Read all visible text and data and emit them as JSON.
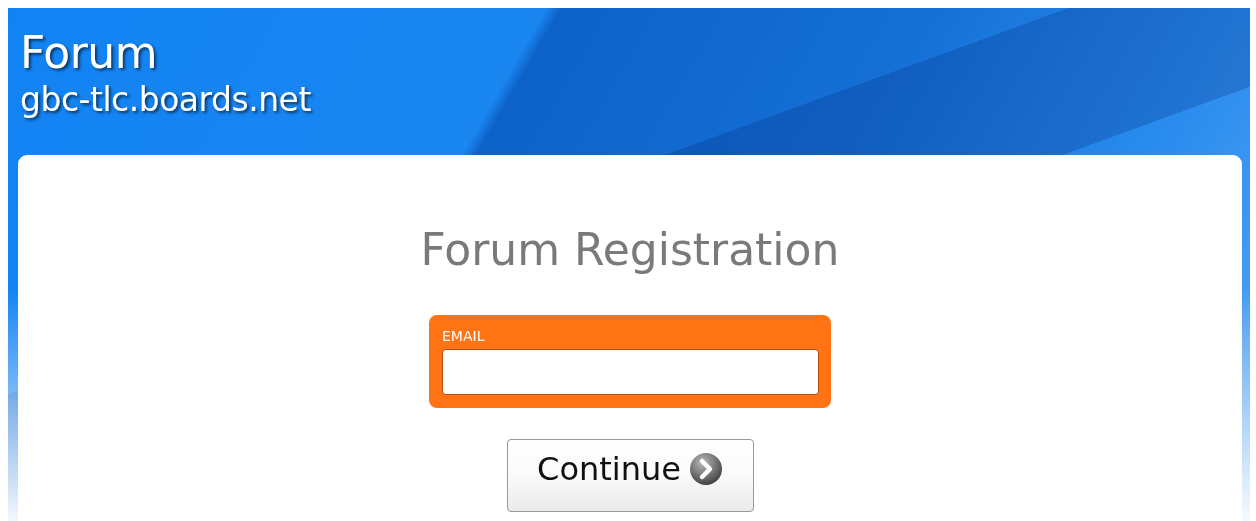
{
  "header": {
    "title": "Forum",
    "subtitle": "gbc-tlc.boards.net"
  },
  "form": {
    "heading": "Forum Registration",
    "field": {
      "label": "EMAIL"
    },
    "button": {
      "label": "Continue"
    }
  }
}
